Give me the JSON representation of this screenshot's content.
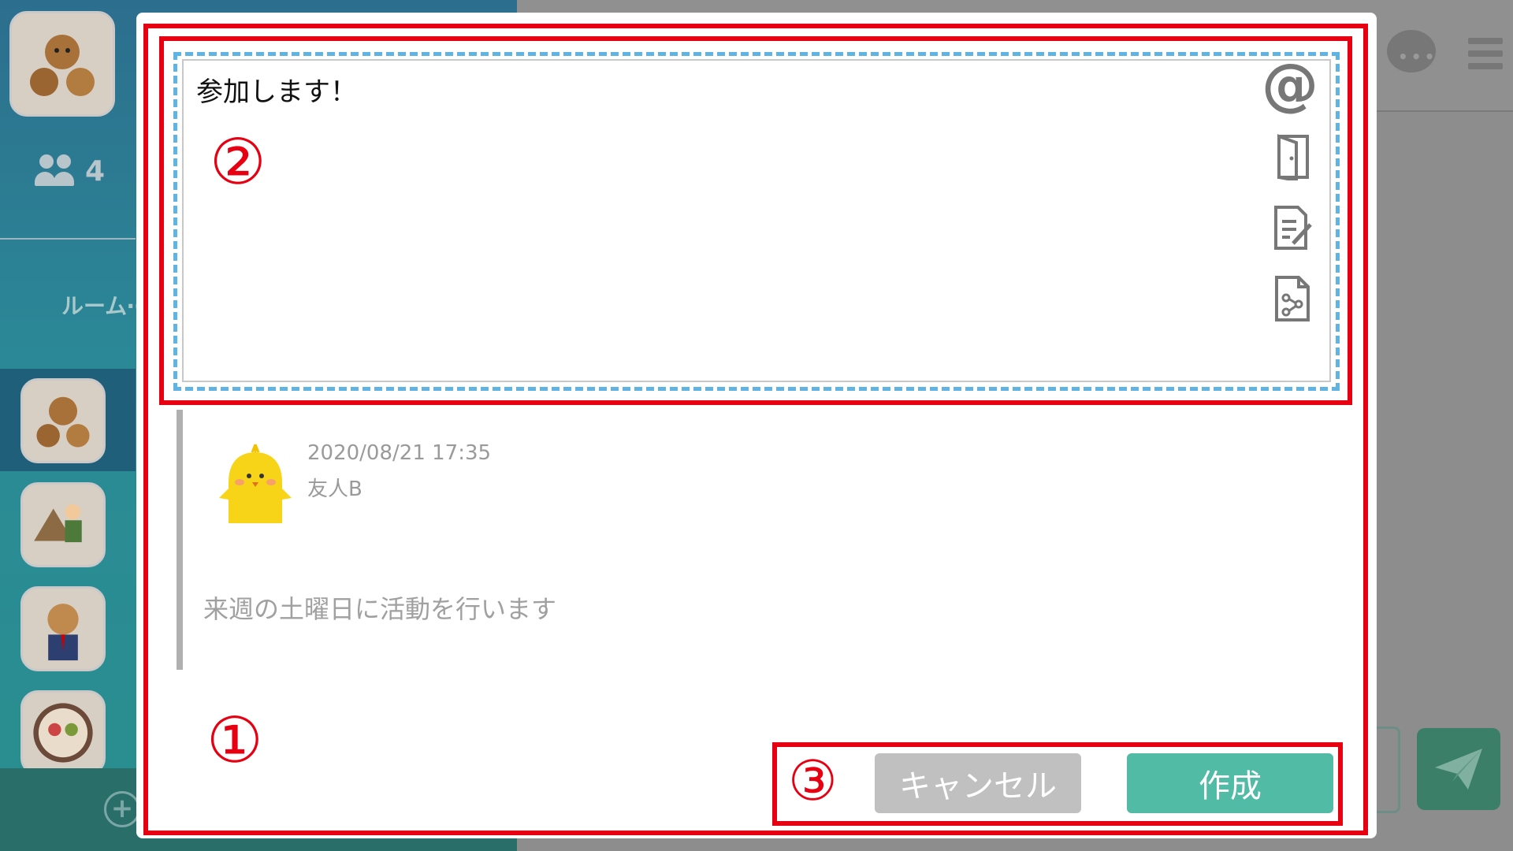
{
  "sidebar": {
    "member_count": "4",
    "room_label": "ルーム⋯"
  },
  "editor": {
    "text": "参加します！",
    "tools": [
      "mention-icon",
      "room-link-icon",
      "note-icon",
      "file-link-icon"
    ],
    "mention_glyph": "@"
  },
  "quoted_post": {
    "date": "2020/08/21 17:35",
    "author": "友人B",
    "message": "来週の土曜日に活動を行います"
  },
  "buttons": {
    "cancel_label": "キャンセル",
    "create_label": "作成"
  },
  "callouts": {
    "modal": "①",
    "editor": "②",
    "buttons": "③"
  },
  "colors": {
    "callout_red": "#e60012",
    "create_green": "#51bba5",
    "cancel_gray": "#c0c0c0",
    "editor_dashed_blue": "#5fb4e4"
  }
}
